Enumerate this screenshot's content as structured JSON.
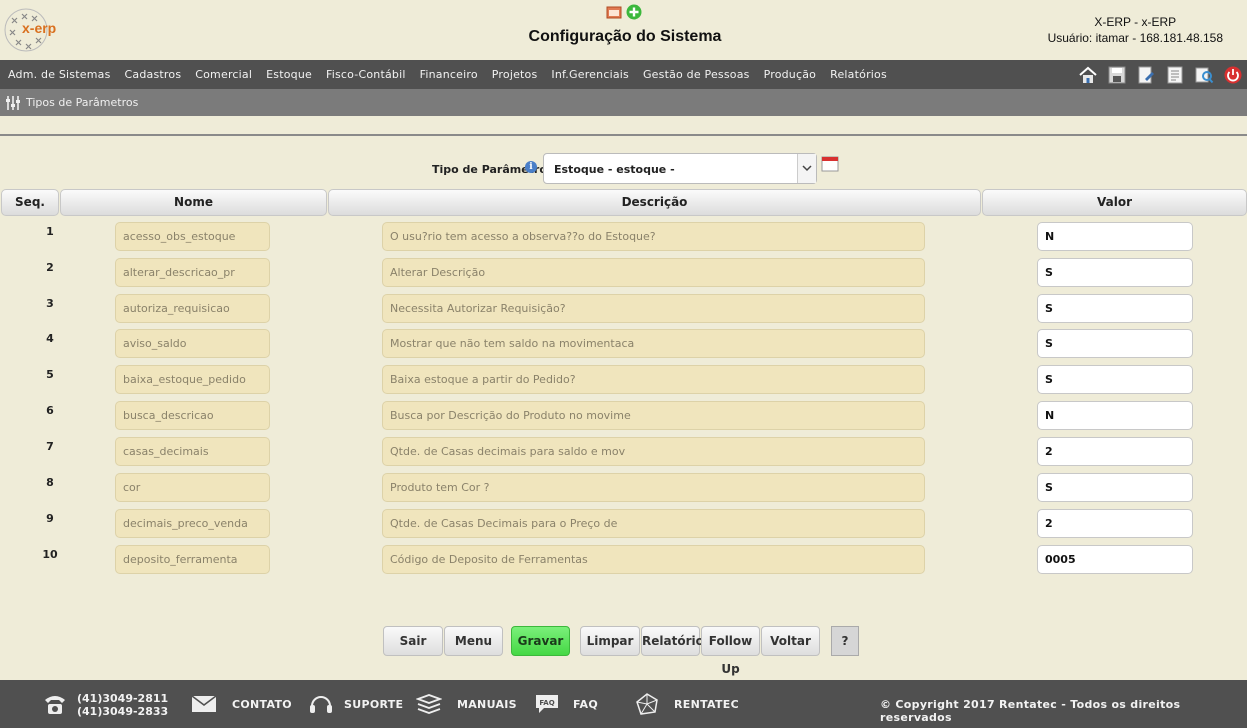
{
  "header": {
    "logo_text": "x-erp",
    "title": "Configuração do Sistema",
    "system": "X-ERP - x-ERP",
    "user": "Usuário: itamar - 168.181.48.158"
  },
  "menu": [
    "Adm. de Sistemas",
    "Cadastros",
    "Comercial",
    "Estoque",
    "Fisco-Contábil",
    "Financeiro",
    "Projetos",
    "Inf.Gerenciais",
    "Gestão de Pessoas",
    "Produção",
    "Relatórios"
  ],
  "toolbar_icons": [
    "home-icon",
    "save-icon",
    "edit-icon",
    "document-icon",
    "search-icon",
    "power-icon"
  ],
  "breadcrumb": "Tipos de Parâmetros",
  "filter": {
    "label": "Tipo de Parâmetro",
    "selected": "Estoque - estoque -"
  },
  "table": {
    "headers": [
      "Seq.",
      "Nome",
      "Descrição",
      "Valor"
    ],
    "rows": [
      {
        "seq": "1",
        "nome": "acesso_obs_estoque",
        "descricao": "O usu?rio tem acesso a observa??o do Estoque?",
        "valor": "N"
      },
      {
        "seq": "2",
        "nome": "alterar_descricao_pr",
        "descricao": "Alterar Descrição",
        "valor": "S"
      },
      {
        "seq": "3",
        "nome": "autoriza_requisicao",
        "descricao": "Necessita Autorizar Requisição?",
        "valor": "S"
      },
      {
        "seq": "4",
        "nome": "aviso_saldo",
        "descricao": "Mostrar que não tem saldo na movimentaca",
        "valor": "S"
      },
      {
        "seq": "5",
        "nome": "baixa_estoque_pedido",
        "descricao": "Baixa estoque a partir do Pedido?",
        "valor": "S"
      },
      {
        "seq": "6",
        "nome": "busca_descricao",
        "descricao": "Busca por Descrição do Produto no movime",
        "valor": "N"
      },
      {
        "seq": "7",
        "nome": "casas_decimais",
        "descricao": "Qtde. de Casas decimais para saldo e mov",
        "valor": "2"
      },
      {
        "seq": "8",
        "nome": "cor",
        "descricao": "Produto tem Cor ?",
        "valor": "S"
      },
      {
        "seq": "9",
        "nome": "decimais_preco_venda",
        "descricao": "Qtde. de Casas Decimais para o Preço de",
        "valor": "2"
      },
      {
        "seq": "10",
        "nome": "deposito_ferramenta",
        "descricao": "Código de Deposito de Ferramentas",
        "valor": "0005"
      }
    ]
  },
  "buttons": {
    "sair": "Sair",
    "menu": "Menu",
    "gravar": "Gravar",
    "limpar": "Limpar",
    "relatorio": "Relatório",
    "follow_up": "Follow Up",
    "voltar": "Voltar",
    "help": "?"
  },
  "footer": {
    "phone1": "(41)3049-2811",
    "phone2": "(41)3049-2833",
    "contato": "CONTATO",
    "suporte": "SUPORTE",
    "manuais": "MANUAIS",
    "faq": "FAQ",
    "faq_icon_text": "FAQ",
    "rentatec": "RENTATEC",
    "copyright": "© Copyright 2017 Rentatec - Todos os direitos reservados"
  }
}
